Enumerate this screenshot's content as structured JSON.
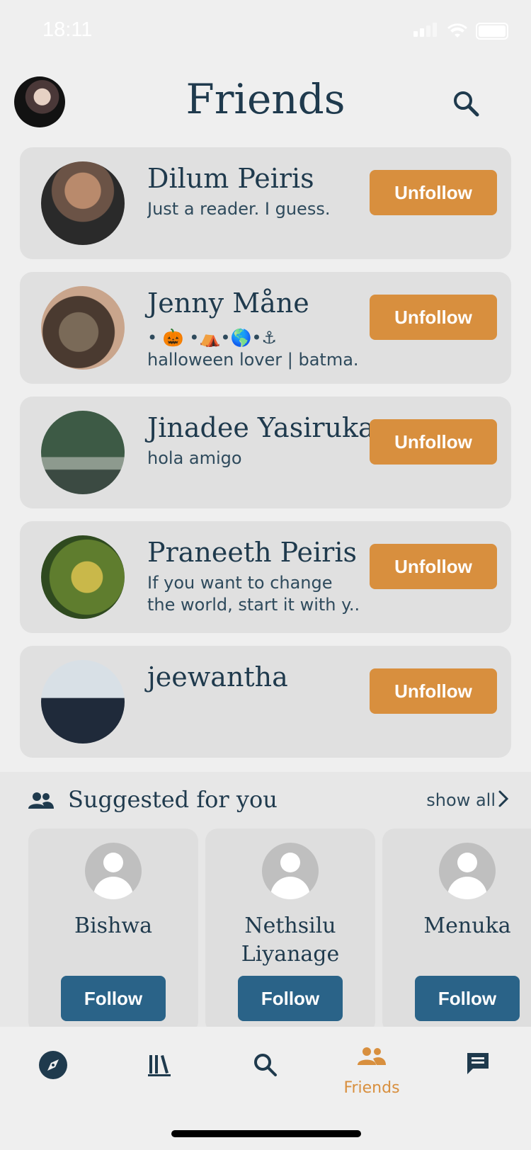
{
  "status_bar": {
    "time": "18:11"
  },
  "header": {
    "title": "Friends"
  },
  "friends": [
    {
      "name": "Dilum Peiris",
      "bio": [
        "Just a reader. I guess."
      ],
      "button": "Unfollow"
    },
    {
      "name": "Jenny Måne",
      "bio": [
        "• 🎃 •⛺•🌎•⚓",
        "halloween lover | batma..."
      ],
      "button": "Unfollow"
    },
    {
      "name": "Jinadee Yasiruka",
      "bio": [
        "hola amigo"
      ],
      "button": "Unfollow"
    },
    {
      "name": "Praneeth Peiris",
      "bio": [
        "If you want to change",
        "the world, start it with y..."
      ],
      "button": "Unfollow"
    },
    {
      "name": "jeewantha",
      "bio": [],
      "button": "Unfollow"
    }
  ],
  "suggested": {
    "title": "Suggested for you",
    "show_all": "show all",
    "items": [
      {
        "name": "Bishwa",
        "button": "Follow"
      },
      {
        "name": "Nethsilu Liyanage",
        "button": "Follow"
      },
      {
        "name": "Menuka",
        "button": "Follow"
      }
    ]
  },
  "tabs": [
    {
      "icon": "compass-icon",
      "label": ""
    },
    {
      "icon": "library-icon",
      "label": ""
    },
    {
      "icon": "search-icon",
      "label": ""
    },
    {
      "icon": "friends-icon",
      "label": "Friends",
      "active": true
    },
    {
      "icon": "chat-icon",
      "label": ""
    }
  ],
  "colors": {
    "accent_orange": "#d88f3e",
    "primary_blue": "#2a6388",
    "text_dark": "#1f3a4d",
    "card_bg": "#e0e0e0"
  }
}
